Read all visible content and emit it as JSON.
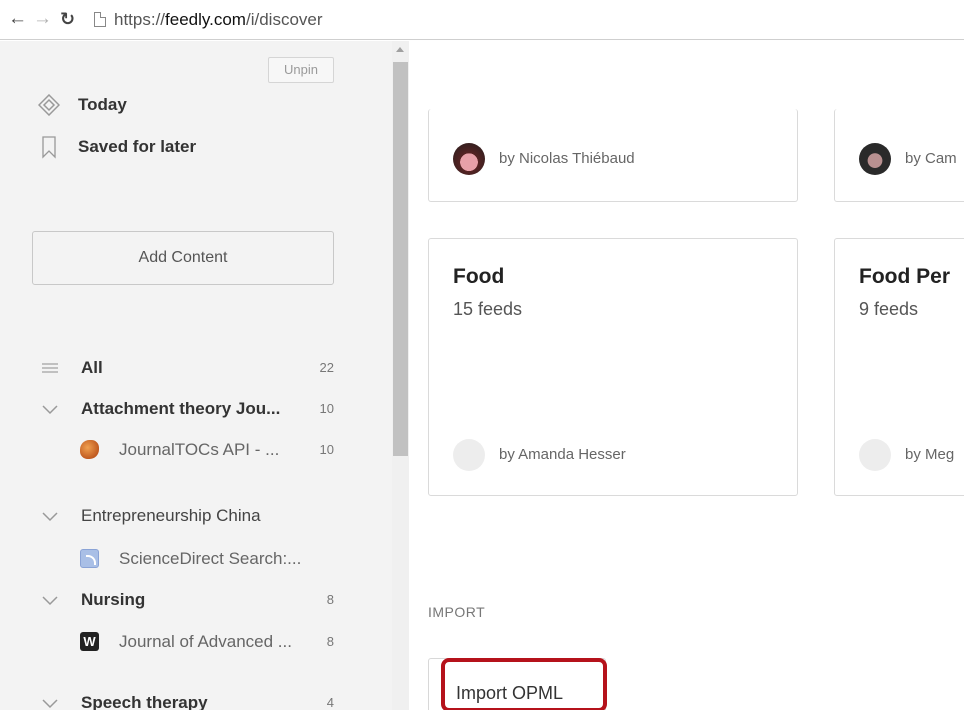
{
  "browser": {
    "url_scheme": "https://",
    "url_host": "feedly.com",
    "url_path": "/i/discover"
  },
  "sidebar": {
    "unpin_label": "Unpin",
    "today_label": "Today",
    "saved_label": "Saved for later",
    "add_content_label": "Add Content",
    "tree": [
      {
        "label": "All",
        "count": "22",
        "bold": true,
        "icon": "list-icon"
      },
      {
        "label": "Attachment theory Jou...",
        "count": "10",
        "bold": true,
        "icon": "chevron-down-icon"
      },
      {
        "label": "JournalTOCs API - ...",
        "count": "10",
        "sub": true,
        "icon": "journaltocs-favicon"
      },
      {
        "label": "Entrepreneurship China",
        "count": "",
        "bold": false,
        "icon": "chevron-down-icon"
      },
      {
        "label": "ScienceDirect Search:...",
        "count": "",
        "sub": true,
        "icon": "rss-favicon"
      },
      {
        "label": "Nursing",
        "count": "8",
        "bold": true,
        "icon": "chevron-down-icon"
      },
      {
        "label": "Journal of Advanced ...",
        "count": "8",
        "sub": true,
        "icon": "w-favicon"
      },
      {
        "label": "Speech therapy",
        "count": "4",
        "bold": true,
        "icon": "chevron-down-icon"
      }
    ]
  },
  "main": {
    "cards": [
      {
        "title": "",
        "feeds": "",
        "byline": "by Nicolas Thiébaud"
      },
      {
        "title": "",
        "feeds": "",
        "byline": "by Cam"
      },
      {
        "title": "Food",
        "feeds": "15 feeds",
        "byline": "by Amanda Hesser"
      },
      {
        "title": "Food Per",
        "feeds": "9 feeds",
        "byline": "by Meg"
      }
    ],
    "import_section_label": "IMPORT",
    "import_button_label": "Import OPML"
  },
  "colors": {
    "sidebar_bg": "#f3f3f3",
    "highlight": "#b5121b"
  }
}
